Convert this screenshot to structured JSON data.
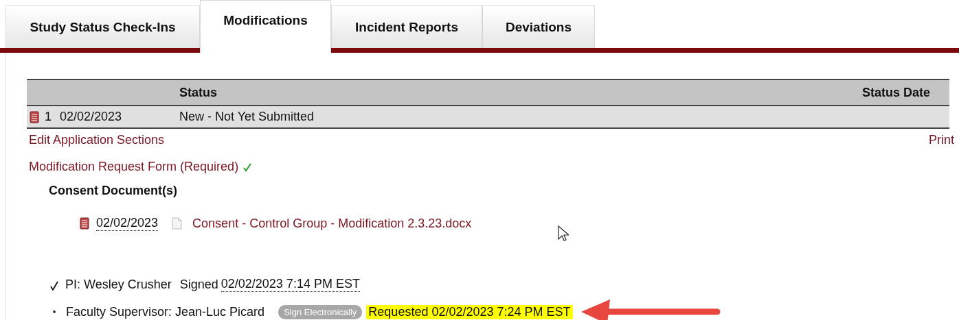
{
  "tabs": [
    {
      "label": "Study Status Check-Ins",
      "selected": false
    },
    {
      "label": "Modifications",
      "selected": true
    },
    {
      "label": "Incident Reports",
      "selected": false
    },
    {
      "label": "Deviations",
      "selected": false
    }
  ],
  "table": {
    "columns": [
      "Status",
      "Status Date"
    ],
    "rows": [
      {
        "number": "1",
        "date": "02/02/2023",
        "status": "New - Not Yet Submitted"
      }
    ]
  },
  "edit_link": "Edit Application Sections",
  "print_link": "Print",
  "form": {
    "label": "Modification Request Form (Required)",
    "complete": true
  },
  "consent": {
    "heading": "Consent Document(s)",
    "documents": [
      {
        "date": "02/02/2023",
        "file": "Consent - Control Group - Modification 2.3.23.docx"
      }
    ]
  },
  "signatures": [
    {
      "kind": "signed",
      "name": "PI: Wesley Crusher",
      "status": "Signed",
      "timestamp": "02/02/2023 7:14 PM EST"
    },
    {
      "kind": "requested",
      "name": "Faculty Supervisor: Jean-Luc Picard",
      "button": "Sign Electronically",
      "status": "Requested 02/02/2023 7:24 PM EST"
    }
  ]
}
